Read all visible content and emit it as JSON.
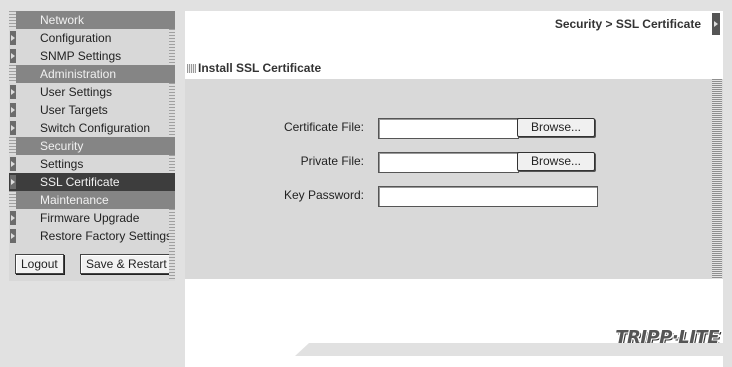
{
  "sidebar": {
    "groups": [
      {
        "title": "Network",
        "items": [
          {
            "label": "Configuration"
          },
          {
            "label": "SNMP Settings"
          }
        ]
      },
      {
        "title": "Administration",
        "items": [
          {
            "label": "User Settings"
          },
          {
            "label": "User Targets"
          },
          {
            "label": "Switch Configuration"
          }
        ]
      },
      {
        "title": "Security",
        "items": [
          {
            "label": "Settings"
          },
          {
            "label": "SSL Certificate",
            "active": true
          }
        ]
      },
      {
        "title": "Maintenance",
        "items": [
          {
            "label": "Firmware Upgrade"
          },
          {
            "label": "Restore Factory Settings"
          }
        ]
      }
    ],
    "logout_label": "Logout",
    "save_restart_label": "Save & Restart"
  },
  "header": {
    "breadcrumb": "Security > SSL Certificate"
  },
  "section": {
    "title": "Install SSL Certificate"
  },
  "form": {
    "certificate_file_label": "Certificate File:",
    "certificate_file_value": "",
    "private_file_label": "Private File:",
    "private_file_value": "",
    "key_password_label": "Key Password:",
    "key_password_value": "",
    "browse_label": "Browse..."
  },
  "brand": {
    "logo_text": "TRIPP·LITE"
  },
  "colors": {
    "header_bg": "#858585",
    "active_bg": "#3d3d3d",
    "item_bg": "#d8d8d8",
    "panel_bg": "#d9d9d9"
  }
}
